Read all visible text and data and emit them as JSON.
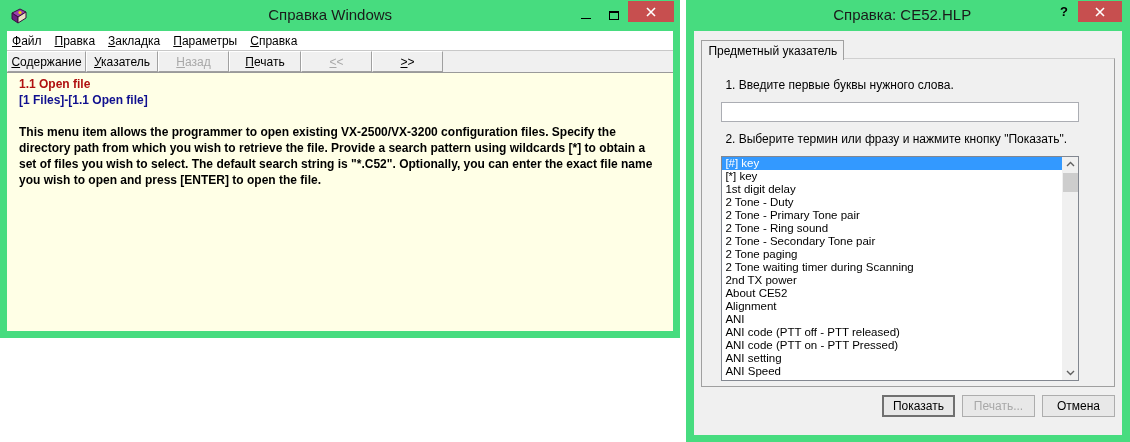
{
  "help_window": {
    "title": "Справка Windows",
    "menu": [
      "Файл",
      "Правка",
      "Закладка",
      "Параметры",
      "Справка"
    ],
    "toolbar": [
      {
        "label": "Содержание",
        "disabled": false
      },
      {
        "label": "Указатель",
        "disabled": false
      },
      {
        "label": "Назад",
        "disabled": true
      },
      {
        "label": "Печать",
        "disabled": false
      },
      {
        "label": "<<",
        "disabled": true
      },
      {
        "label": ">>",
        "disabled": false
      }
    ],
    "topic_title": "1.1 Open file",
    "breadcrumb": "[1 Files]-[1.1 Open file]",
    "body": "This menu item allows the programmer to open existing VX-2500/VX-3200 configuration files. Specify the directory path from which you wish to retrieve the file. Provide a search pattern using wildcards [*] to obtain a set of files you wish to select. The default search string is \"*.C52\". Optionally, you can enter the exact file name you wish to open and press [ENTER] to open the file."
  },
  "index_dialog": {
    "title": "Справка: CE52.HLP",
    "help_button": "?",
    "tabs": [
      {
        "label": "Предметный указатель",
        "selected": true
      }
    ],
    "step_1": "1. Введите первые буквы нужного слова.",
    "step_2": "2. Выберите термин или фразу и нажмите кнопку \"Показать\".",
    "items": [
      {
        "label": "[#] key",
        "selected": true
      },
      {
        "label": "[*] key",
        "selected": false
      },
      {
        "label": "1st digit delay",
        "selected": false
      },
      {
        "label": "2 Tone - Duty",
        "selected": false
      },
      {
        "label": "2 Tone - Primary Tone pair",
        "selected": false
      },
      {
        "label": "2 Tone - Ring sound",
        "selected": false
      },
      {
        "label": "2 Tone - Secondary Tone pair",
        "selected": false
      },
      {
        "label": "2 Tone paging",
        "selected": false
      },
      {
        "label": "2 Tone waiting timer during Scanning",
        "selected": false
      },
      {
        "label": "2nd TX power",
        "selected": false
      },
      {
        "label": "About CE52",
        "selected": false
      },
      {
        "label": "Alignment",
        "selected": false
      },
      {
        "label": "ANI",
        "selected": false
      },
      {
        "label": "ANI code (PTT off - PTT released)",
        "selected": false
      },
      {
        "label": "ANI code (PTT on - PTT Pressed)",
        "selected": false
      },
      {
        "label": "ANI setting",
        "selected": false
      },
      {
        "label": "ANI Speed",
        "selected": false
      }
    ],
    "buttons": [
      {
        "label": "Показать",
        "disabled": false,
        "default": true
      },
      {
        "label": "Печать...",
        "disabled": true,
        "default": false
      },
      {
        "label": "Отмена",
        "disabled": false,
        "default": false
      }
    ]
  }
}
